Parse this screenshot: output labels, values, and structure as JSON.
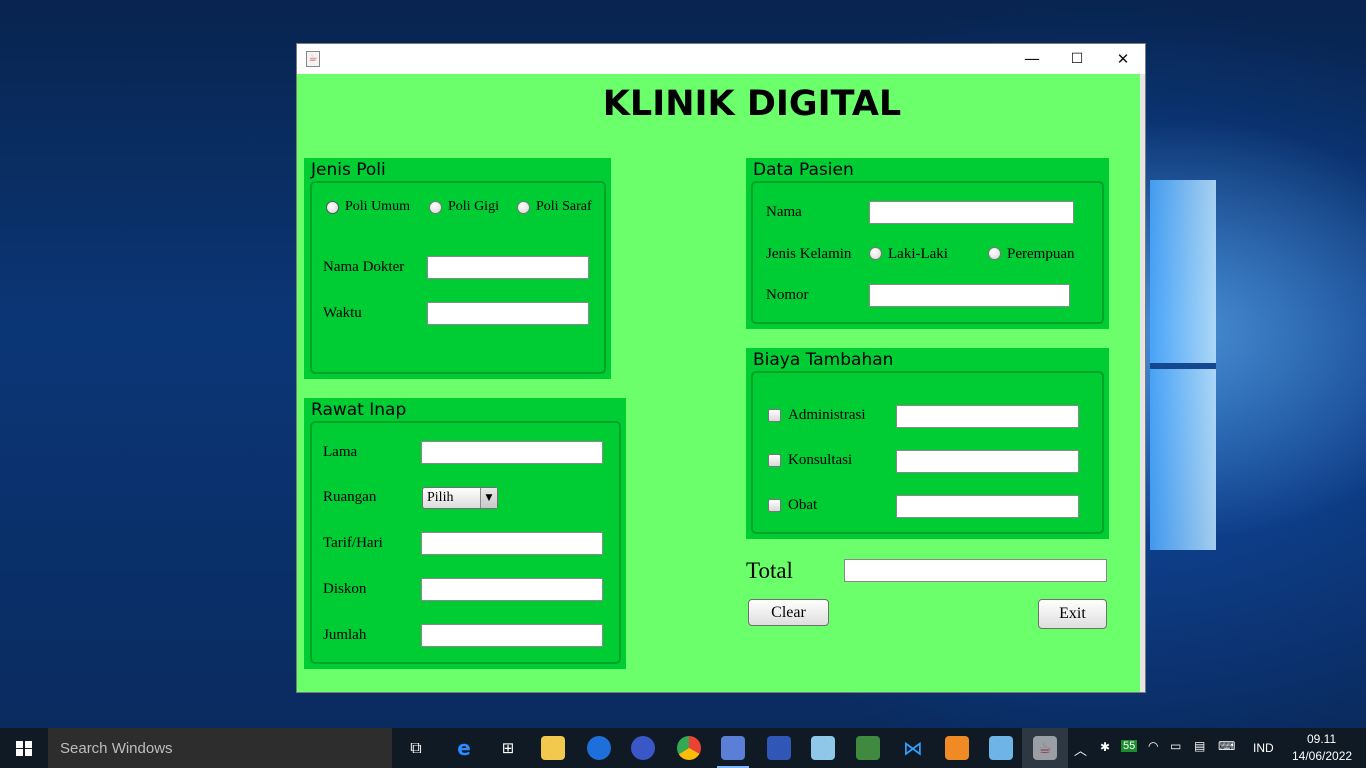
{
  "app": {
    "title": "KLINIK DIGITAL",
    "window_controls": {
      "minimize": "—",
      "maximize": "☐",
      "close": "✕"
    }
  },
  "jenis_poli": {
    "title": "Jenis Poli",
    "options": [
      "Poli Umum",
      "Poli Gigi",
      "Poli Saraf"
    ],
    "nama_dokter_label": "Nama Dokter",
    "nama_dokter_value": "",
    "waktu_label": "Waktu",
    "waktu_value": ""
  },
  "rawat_inap": {
    "title": "Rawat Inap",
    "lama_label": "Lama",
    "lama_value": "",
    "ruangan_label": "Ruangan",
    "ruangan_selected": "Pilih",
    "tarif_label": "Tarif/Hari",
    "tarif_value": "",
    "diskon_label": "Diskon",
    "diskon_value": "",
    "jumlah_label": "Jumlah",
    "jumlah_value": ""
  },
  "data_pasien": {
    "title": "Data Pasien",
    "nama_label": "Nama",
    "nama_value": "",
    "jenis_kelamin_label": "Jenis Kelamin",
    "gender_options": [
      "Laki-Laki",
      "Perempuan"
    ],
    "nomor_label": "Nomor",
    "nomor_value": ""
  },
  "biaya_tambahan": {
    "title": "Biaya Tambahan",
    "items": [
      {
        "label": "Administrasi",
        "value": ""
      },
      {
        "label": "Konsultasi",
        "value": ""
      },
      {
        "label": "Obat",
        "value": ""
      }
    ]
  },
  "total": {
    "label": "Total",
    "value": ""
  },
  "buttons": {
    "clear": "Clear",
    "exit": "Exit"
  },
  "taskbar": {
    "search_placeholder": "Search Windows",
    "battery_badge": "55",
    "language": "IND",
    "time": "09.11",
    "date": "14/06/2022"
  },
  "colors": {
    "content_bg": "#6bff6b",
    "panel_bg": "#00cc33",
    "taskbar_bg": "#101a24"
  }
}
